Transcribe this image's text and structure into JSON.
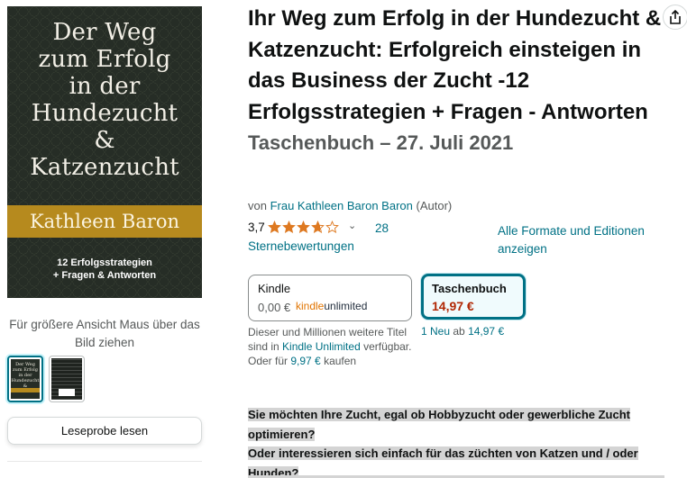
{
  "cover": {
    "title": "Der Weg\nzum Erfolg\nin der\nHundezucht\n&\nKatzenzucht",
    "author": "Kathleen Baron",
    "subtitle": "12 Erfolgsstrategien\n+ Fragen & Antworten",
    "thumb_title": "Der Weg\nzum Erfolg\nin der\nHundezucht\n&\nKatzenzucht"
  },
  "gallery": {
    "zoom_hint": "Für größere Ansicht Maus über das Bild ziehen",
    "preview_button": "Leseprobe lesen",
    "cut_text": "…"
  },
  "product": {
    "title": "Ihr Weg zum Erfolg in der Hundezucht & Katzenzucht: Erfolgreich einsteigen in das Business der Zucht -12 Erfolgsstrategien + Fragen - Antworten",
    "format_date": "Taschenbuch – 27. Juli 2021",
    "by_prefix": "von",
    "author": "Frau Kathleen Baron Baron",
    "author_role": "(Autor)",
    "rating_value": "3,7",
    "rating_stars": 3.7,
    "rating_count": "28",
    "rating_count_label": "Sternebewertungen",
    "all_formats": "Alle Formate und Editionen anzeigen"
  },
  "formats": {
    "kindle": {
      "name": "Kindle",
      "price": "0,00 €",
      "logo_part1": "kindle",
      "logo_part2": "unlimited"
    },
    "paperback": {
      "name": "Taschenbuch",
      "price": "14,97 €"
    }
  },
  "kindle_note": {
    "text1": "Dieser und Millionen weitere Titel sind in",
    "link1": "Kindle Unlimited",
    "text2": "verfügbar. Oder für",
    "price": "9,97 €",
    "text3": "kaufen"
  },
  "offers": {
    "new_link": "1 Neu",
    "ab": "ab",
    "price": "14,97 €"
  },
  "description": {
    "line1": "Sie möchten Ihre Zucht, egal ob Hobbyzucht oder gewerbliche Zucht optimieren?",
    "line2": "Oder interessieren sich einfach für das züchten von Katzen und / oder Hunden?"
  },
  "colors": {
    "link": "#007185",
    "price": "#b12704",
    "cover_bg": "#262d26",
    "cover_band": "#b68a1e",
    "ku_orange": "#e17400"
  },
  "icons": {
    "share": "share-icon",
    "chevron": "chevron-down-icon",
    "star": "star-icon"
  }
}
